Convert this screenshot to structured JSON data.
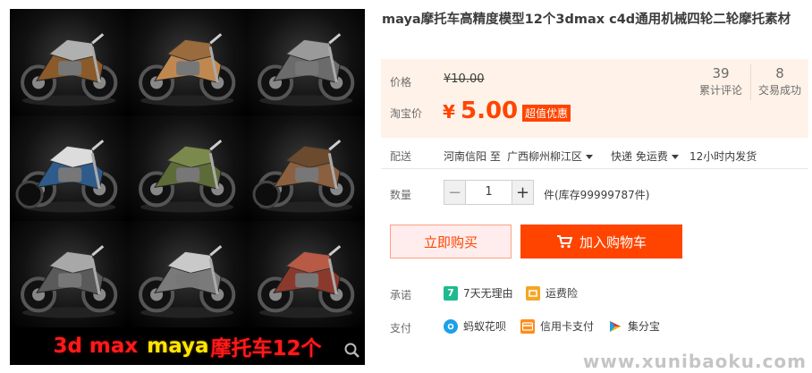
{
  "product": {
    "title": "maya摩托车高精度模型12个3dmax c4d通用机械四轮二轮摩托素材"
  },
  "gallery": {
    "caption_part1": "3d max",
    "caption_part2": "maya",
    "caption_part3": "摩托车12个",
    "tile_count": 9,
    "zoom_icon": "zoom-icon"
  },
  "price": {
    "price_label": "价格",
    "original_price": "¥10.00",
    "taobao_price_label": "淘宝价",
    "currency_symbol": "¥",
    "current_price": "5.00",
    "promo_tag": "超值优惠",
    "reviews_count": "39",
    "reviews_label": "累计评论",
    "sales_count": "8",
    "sales_label": "交易成功"
  },
  "shipping": {
    "label": "配送",
    "origin": "河南信阳 至",
    "destination": "广西柳州柳江区",
    "method": "快递 免运费",
    "dispatch_time": "12小时内发货"
  },
  "quantity": {
    "label": "数量",
    "minus": "−",
    "value": "1",
    "plus": "+",
    "stock": "件(库存99999787件)"
  },
  "actions": {
    "buy_now": "立即购买",
    "add_to_cart": "加入购物车"
  },
  "promise": {
    "label": "承诺",
    "items": [
      {
        "icon": "seven-day-return-icon",
        "text": "7天无理由",
        "color": "#1cbb8f"
      },
      {
        "icon": "shipping-insurance-icon",
        "text": "运费险",
        "color": "#f5a623"
      }
    ]
  },
  "payment": {
    "label": "支付",
    "items": [
      {
        "icon": "huabei-icon",
        "text": "蚂蚁花呗",
        "color": "#1ca0e8"
      },
      {
        "icon": "credit-card-icon",
        "text": "信用卡支付",
        "color": "#ff8c1a"
      },
      {
        "icon": "jifenbao-icon",
        "text": "集分宝",
        "color": "#2bb24c"
      }
    ]
  },
  "colors": {
    "accent": "#ff4400",
    "price_panel_bg": "#fff2e8"
  },
  "watermark": "www.xunibaoku.com"
}
